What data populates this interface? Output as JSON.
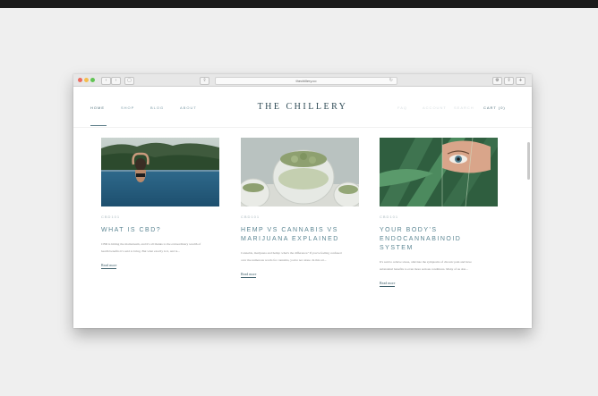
{
  "browser": {
    "url": "thechillery.co",
    "back": "‹",
    "forward": "›",
    "sidebar": "▢",
    "share": "⇪",
    "reload": "↻",
    "ext1": "⚙",
    "ext2": "⇪",
    "ext3": "+"
  },
  "nav": {
    "brand": "THE CHILLERY",
    "items": [
      {
        "label": "HOME"
      },
      {
        "label": "SHOP"
      },
      {
        "label": "BLOG"
      },
      {
        "label": "ABOUT"
      }
    ],
    "right_items": [
      {
        "label": "FAQ"
      },
      {
        "label": "ACCOUNT"
      },
      {
        "label": "SEARCH"
      }
    ],
    "cart": "CART (0)"
  },
  "cards": [
    {
      "category": "CBD101",
      "title": "WHAT IS CBD?",
      "text": "CBD is hitting the mainstream, and it's all thanks to the extraordinary wealth of health benefits it's said to bring. But what exactly is it, and is...",
      "link": "Read more",
      "image": "woman-infinity-pool-photo"
    },
    {
      "category": "CBD101",
      "title": "HEMP VS CANNABIS VS MARIJUANA EXPLAINED",
      "text": "Cannabis, marijuana and hemp: what's the difference? If you're feeling confused over the numerous words for cannabis, you're not alone. In this art...",
      "link": "Read more",
      "image": "cannabis-jars-photo"
    },
    {
      "category": "CBD101",
      "title": "YOUR BODY'S ENDOCANNABINOID SYSTEM",
      "text": "It's said to relieve stress, alleviate the symptoms of chronic pain and have substantial benefits to even more serious conditions. Many of us don...",
      "link": "Read more",
      "image": "eye-through-leaf-photo"
    }
  ],
  "colors": {
    "accent": "#5d8794",
    "brand": "#2f4b56"
  }
}
